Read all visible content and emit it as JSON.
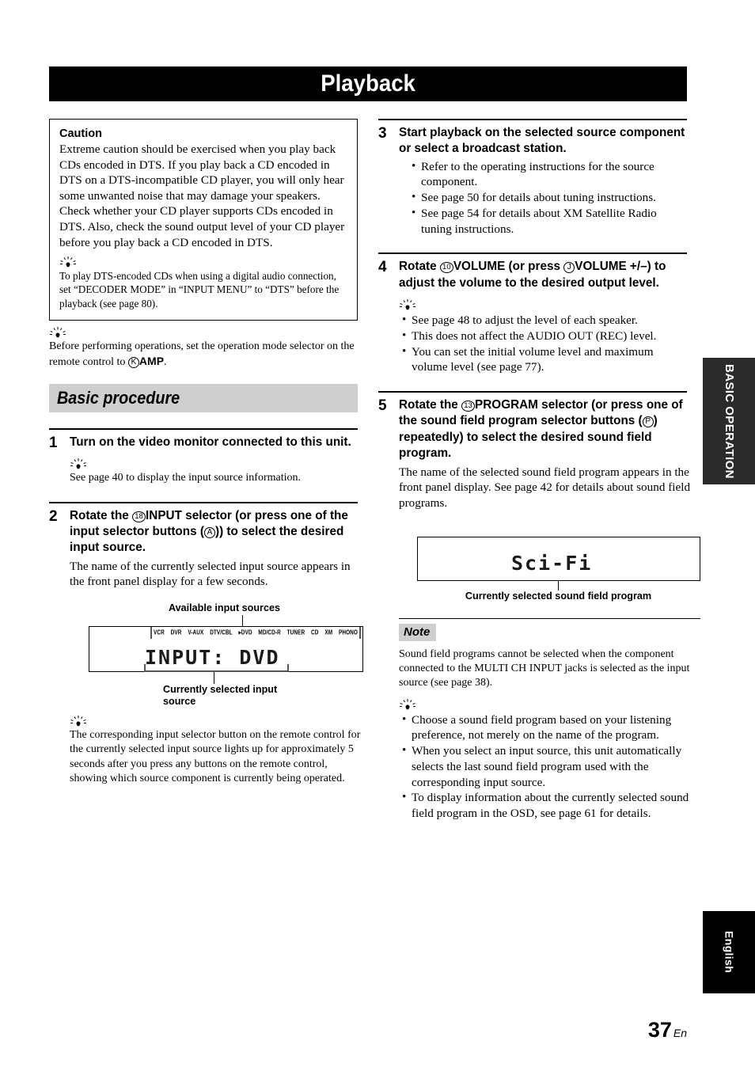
{
  "page": {
    "title": "Playback",
    "number": "37",
    "lang_suffix": "En"
  },
  "side_tabs": {
    "section": "BASIC OPERATION",
    "language": "English"
  },
  "caution": {
    "heading": "Caution",
    "body": "Extreme caution should be exercised when you play back CDs encoded in DTS. If you play back a CD encoded in DTS on a DTS-incompatible CD player, you will only hear some unwanted noise that may damage your speakers. Check whether your CD player supports CDs encoded in DTS. Also, check the sound output level of your CD player before you play back a CD encoded in DTS.",
    "tip": "To play DTS-encoded CDs when using a digital audio connection, set “DECODER MODE” in “INPUT MENU” to “DTS” before the playback (see page 80)."
  },
  "intro_tip": {
    "text_before": "Before performing operations, set the operation mode selector on the remote control to ",
    "circled": "K",
    "bold": "AMP",
    "text_after": "."
  },
  "section_heading": "Basic procedure",
  "steps": {
    "step1": {
      "num": "1",
      "title": "Turn on the video monitor connected to this unit.",
      "tip": "See page 40 to display the input source information."
    },
    "step2": {
      "num": "2",
      "title_a": "Rotate the ",
      "circled_1": "18",
      "bold_1": "INPUT",
      "title_b": " selector (or press one of the input selector buttons (",
      "circled_2": "A",
      "title_c": ")) to select the desired input source.",
      "desc": "The name of the currently selected input source appears in the front panel display for a few seconds.",
      "tip": "The corresponding input selector button on the remote control for the currently selected input source lights up for approximately 5 seconds after you press any buttons on the remote control, showing which source component is currently being operated."
    },
    "step3": {
      "num": "3",
      "title": "Start playback on the selected source component or select a broadcast station.",
      "bullets": [
        "Refer to the operating instructions for the source component.",
        "See page 50 for details about tuning instructions.",
        "See page 54 for details about XM Satellite Radio tuning instructions."
      ]
    },
    "step4": {
      "num": "4",
      "title_a": "Rotate ",
      "circled_1": "10",
      "bold_1": "VOLUME",
      "title_b": " (or press ",
      "circled_2": "J",
      "bold_2": "VOLUME +/",
      "title_c": "–) to adjust the volume to the desired output level.",
      "tip_bullets": [
        "See page 48 to adjust the level of each speaker.",
        "This does not affect the AUDIO OUT (REC) level.",
        "You can set the initial volume level and maximum volume level (see page 77)."
      ]
    },
    "step5": {
      "num": "5",
      "title_a": "Rotate the ",
      "circled_1": "13",
      "bold_1": "PROGRAM",
      "title_b": " selector (or press one of the sound field program selector buttons (",
      "circled_2": "P",
      "title_c": ") repeatedly) to select the desired sound field program.",
      "desc": "The name of the selected sound field program appears in the front panel display. See page 42 for details about sound field programs."
    }
  },
  "figure_input": {
    "caption_top": "Available input sources",
    "caption_bottom_line1": "Currently selected input",
    "caption_bottom_line2": "source",
    "display_text": "INPUT: DVD",
    "sources": [
      "VCR",
      "DVR",
      "V-AUX",
      "DTV/CBL",
      "▸DVD",
      "MD/CD-R",
      "TUNER",
      "CD",
      "XM",
      "PHONO"
    ]
  },
  "figure_program": {
    "display_text": "Sci-Fi",
    "caption_bottom": "Currently selected sound field program"
  },
  "note": {
    "tag": "Note",
    "body": "Sound field programs cannot be selected when the component connected to the MULTI CH INPUT jacks is selected as the input source (see page 38).",
    "tip_bullets": [
      "Choose a sound field program based on your listening preference, not merely on the name of the program.",
      "When you select an input source, this unit automatically selects the last sound field program used with the corresponding input source.",
      "To display information about the currently selected sound field program in the OSD, see page 61 for details."
    ]
  },
  "colors": {
    "band_gray": "#cfcfcf",
    "tab_dark": "#2b2b2b",
    "black": "#000000"
  }
}
